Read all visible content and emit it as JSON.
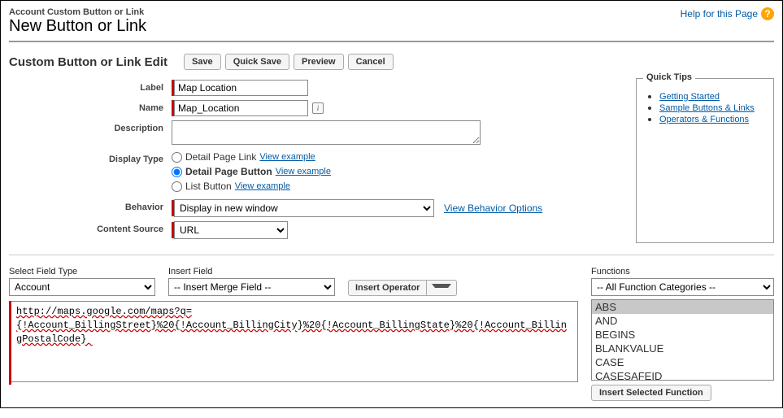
{
  "header": {
    "breadcrumb": "Account Custom Button or Link",
    "title": "New Button or Link",
    "help_label": "Help for this Page"
  },
  "section": {
    "title": "Custom Button or Link Edit",
    "buttons": {
      "save": "Save",
      "quick_save": "Quick Save",
      "preview": "Preview",
      "cancel": "Cancel"
    }
  },
  "form": {
    "labels": {
      "label": "Label",
      "name": "Name",
      "description": "Description",
      "display_type": "Display Type",
      "behavior": "Behavior",
      "content_source": "Content Source"
    },
    "values": {
      "label": "Map Location",
      "name": "Map_Location",
      "description": ""
    },
    "display_type": {
      "options": [
        {
          "label": "Detail Page Link",
          "example": "View example",
          "selected": false
        },
        {
          "label": "Detail Page Button",
          "example": "View example",
          "selected": true
        },
        {
          "label": "List Button",
          "example": "View example",
          "selected": false
        }
      ]
    },
    "behavior": {
      "selected": "Display in new window",
      "link": "View Behavior Options"
    },
    "content_source": {
      "selected": "URL"
    }
  },
  "quick_tips": {
    "title": "Quick Tips",
    "links": [
      "Getting Started",
      "Sample Buttons & Links",
      "Operators & Functions"
    ]
  },
  "formula": {
    "select_field_type": {
      "label": "Select Field Type",
      "value": "Account"
    },
    "insert_field": {
      "label": "Insert Field",
      "value": "-- Insert Merge Field --"
    },
    "insert_operator": "Insert Operator",
    "text": "http://maps.google.com/maps?q={!Account_BillingStreet}%20{!Account_BillingCity}%20{!Account_BillingState}%20{!Account_BillingPostalCode} "
  },
  "functions": {
    "label": "Functions",
    "category": "-- All Function Categories --",
    "list": [
      "ABS",
      "AND",
      "BEGINS",
      "BLANKVALUE",
      "CASE",
      "CASESAFEID"
    ],
    "selected": "ABS",
    "insert_button": "Insert Selected Function"
  }
}
